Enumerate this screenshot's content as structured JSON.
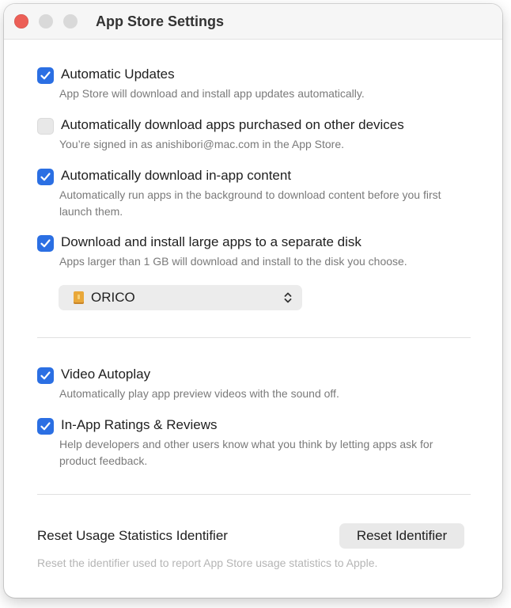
{
  "window": {
    "title": "App Store Settings"
  },
  "options": [
    {
      "label": "Automatic Updates",
      "description": "App Store will download and install app updates automatically.",
      "checked": true
    },
    {
      "label": "Automatically download apps purchased on other devices",
      "description": "You’re signed in as anishibori@mac.com in the App Store.",
      "checked": false
    },
    {
      "label": "Automatically download in-app content",
      "description": "Automatically run apps in the background to download content before you first launch them.",
      "checked": true
    },
    {
      "label": "Download and install large apps to a separate disk",
      "description": "Apps larger than 1 GB will download and install to the disk you choose.",
      "checked": true
    },
    {
      "label": "Video Autoplay",
      "description": "Automatically play app preview videos with the sound off.",
      "checked": true
    },
    {
      "label": "In-App Ratings & Reviews",
      "description": "Help developers and other users know what you think by letting apps ask for product feedback.",
      "checked": true
    }
  ],
  "disk_select": {
    "selected": "ORICO",
    "icon": "external-drive-icon"
  },
  "reset": {
    "label": "Reset Usage Statistics Identifier",
    "button": "Reset Identifier",
    "description": "Reset the identifier used to report App Store usage statistics to Apple."
  },
  "colors": {
    "accent": "#2b6fe3",
    "close_button": "#ec5f57"
  }
}
